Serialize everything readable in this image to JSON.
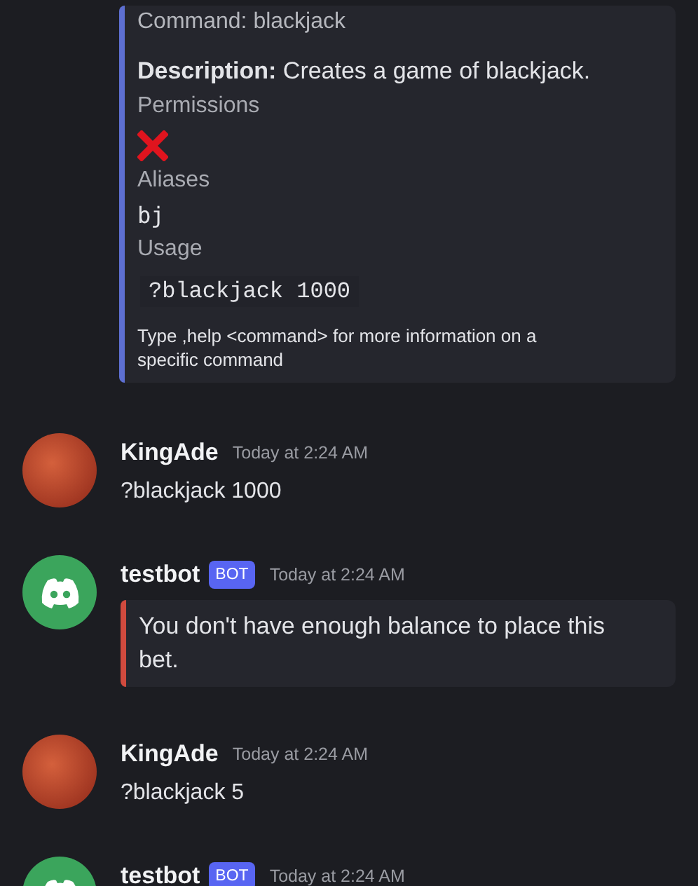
{
  "embed": {
    "color": "#5d6fd1",
    "title": "Command: blackjack",
    "description": "**Description:** Creates a game of blackjack.",
    "fields": [
      {
        "name": "Permissions",
        "kind": "cross"
      },
      {
        "name": "Aliases",
        "kind": "code",
        "value": "bj"
      },
      {
        "name": "Usage",
        "kind": "codeblock",
        "value": "?blackjack 1000"
      }
    ],
    "footer": "Type ,help <command> for more information on a specific command"
  },
  "messages": [
    {
      "author": "KingAde",
      "bot": false,
      "time": "Today at 2:24 AM",
      "content": "?blackjack 1000"
    },
    {
      "author": "testbot",
      "bot": true,
      "badge": "BOT",
      "time": "Today at 2:24 AM",
      "embed": {
        "color": "#d04a3e",
        "description": "You don't have enough balance to place this bet."
      }
    },
    {
      "author": "KingAde",
      "bot": false,
      "time": "Today at 2:24 AM",
      "content": "?blackjack 5"
    },
    {
      "author": "testbot",
      "bot": true,
      "badge": "BOT",
      "time": "Today at 2:24 AM"
    }
  ]
}
